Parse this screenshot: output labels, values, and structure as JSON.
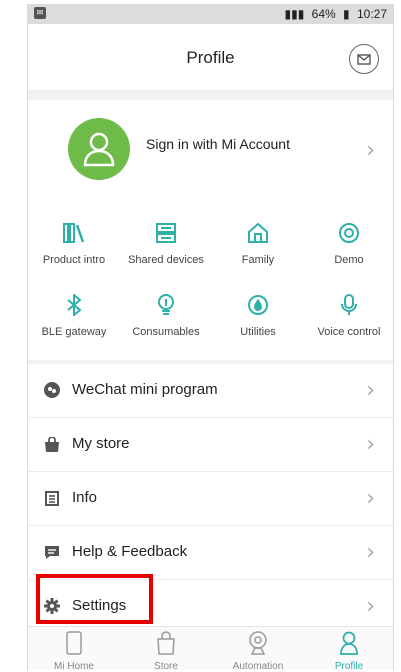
{
  "status_bar": {
    "battery": "64%",
    "time": "10:27"
  },
  "header": {
    "title": "Profile",
    "mail_icon": "mail-icon"
  },
  "account": {
    "sign_in_label": "Sign in with Mi Account",
    "avatar_icon": "person-icon"
  },
  "features": [
    {
      "label": "Product intro",
      "icon": "books-icon"
    },
    {
      "label": "Shared devices",
      "icon": "server-icon"
    },
    {
      "label": "Family",
      "icon": "home-icon"
    },
    {
      "label": "Demo",
      "icon": "target-icon"
    },
    {
      "label": "BLE gateway",
      "icon": "bluetooth-icon"
    },
    {
      "label": "Consumables",
      "icon": "bulb-icon"
    },
    {
      "label": "Utilities",
      "icon": "drop-icon"
    },
    {
      "label": "Voice control",
      "icon": "mic-icon"
    }
  ],
  "menu": [
    {
      "label": "WeChat mini program",
      "icon": "wechat-icon"
    },
    {
      "label": "My store",
      "icon": "store-icon"
    },
    {
      "label": "Info",
      "icon": "info-icon"
    },
    {
      "label": "Help & Feedback",
      "icon": "feedback-icon"
    },
    {
      "label": "Settings",
      "icon": "gear-icon"
    }
  ],
  "tabs": [
    {
      "label": "Mi Home",
      "icon": "phone-icon"
    },
    {
      "label": "Store",
      "icon": "bag-icon"
    },
    {
      "label": "Automation",
      "icon": "automation-icon"
    },
    {
      "label": "Profile",
      "icon": "profile-icon"
    }
  ],
  "colors": {
    "accent": "#2fb0a8",
    "avatar_bg": "#6fbb4a",
    "highlight": "#e60000"
  }
}
